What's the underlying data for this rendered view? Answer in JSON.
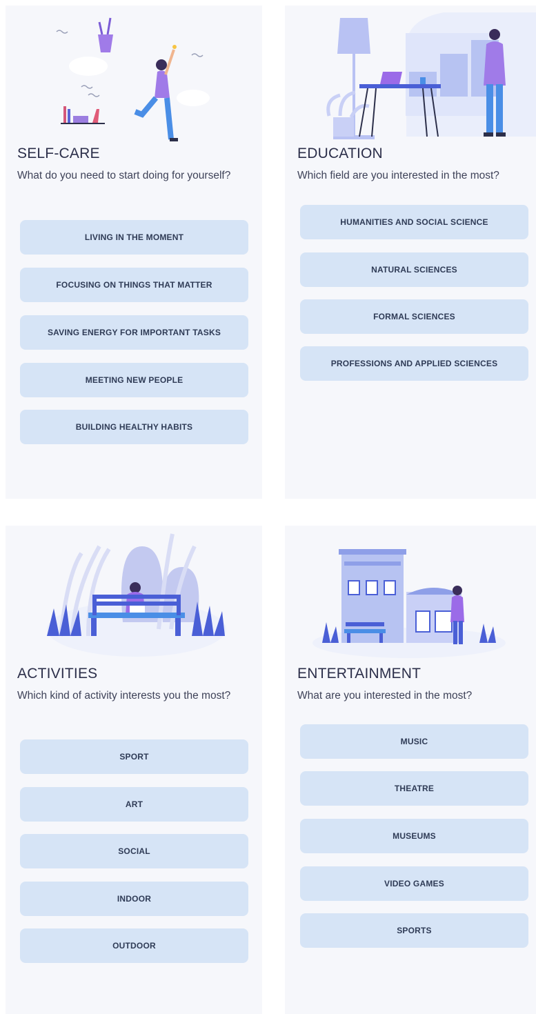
{
  "cards": [
    {
      "title": "SELF-CARE",
      "subtitle": "What do you need to start doing for yourself?",
      "illustration": "woman-jumping-illustration",
      "options": [
        "LIVING IN THE MOMENT",
        "FOCUSING ON THINGS THAT MATTER",
        "SAVING ENERGY FOR IMPORTANT TASKS",
        "MEETING NEW PEOPLE",
        "BUILDING HEALTHY HABITS"
      ]
    },
    {
      "title": "EDUCATION",
      "subtitle": "Which field are you interested in the most?",
      "illustration": "man-at-desk-illustration",
      "options": [
        "HUMANITIES AND SOCIAL SCIENCE",
        "NATURAL SCIENCES",
        "FORMAL SCIENCES",
        "PROFESSIONS AND APPLIED SCIENCES"
      ]
    },
    {
      "title": "ACTIVITIES",
      "subtitle": "Which kind of activity interests you the most?",
      "illustration": "person-on-bench-illustration",
      "options": [
        "SPORT",
        "ART",
        "SOCIAL",
        "INDOOR",
        "OUTDOOR"
      ]
    },
    {
      "title": "ENTERTAINMENT",
      "subtitle": "What are you interested in the most?",
      "illustration": "city-street-illustration",
      "options": [
        "MUSIC",
        "THEATRE",
        "MUSEUMS",
        "VIDEO GAMES",
        "SPORTS"
      ]
    }
  ],
  "colors": {
    "card_bg": "#f6f7fb",
    "option_bg": "#d6e4f6",
    "accent_purple": "#9b6be8",
    "accent_blue": "#4a5fd6"
  }
}
